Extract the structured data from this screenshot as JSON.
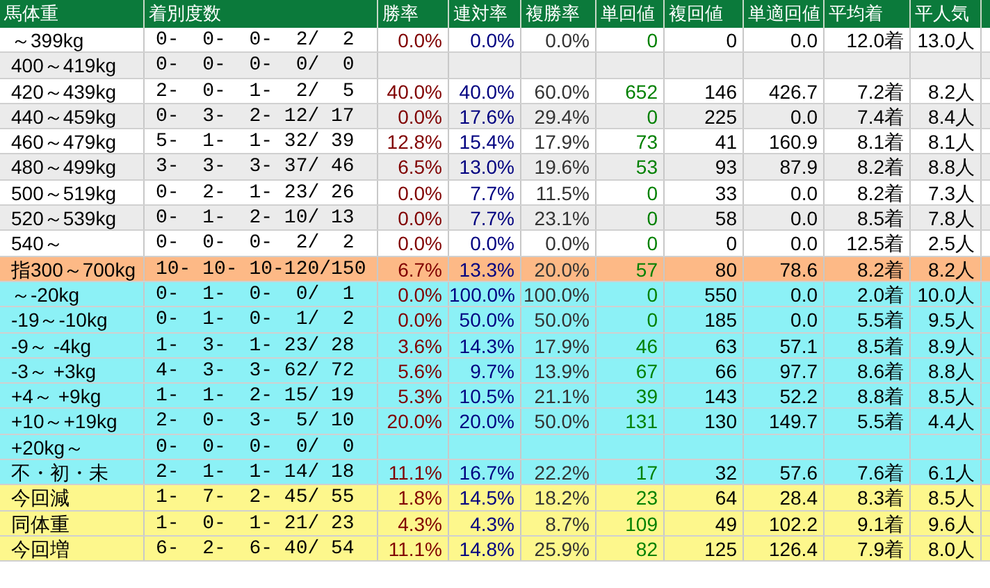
{
  "columns": [
    "馬体重",
    "着別度数",
    "勝率",
    "連対率",
    "複勝率",
    "単回値",
    "複回値",
    "単適回値",
    "平均着",
    "平人気"
  ],
  "rows": [
    {
      "kind": "weight",
      "label": "～399kg",
      "record": "0-  0-  0-  2/  2",
      "stats": [
        "0.0%",
        "0.0%",
        "0.0%",
        "0",
        "0",
        "0.0",
        "12.0着",
        "13.0人"
      ]
    },
    {
      "kind": "weight",
      "label": "400～419kg",
      "record": "0-  0-  0-  0/  0"
    },
    {
      "kind": "weight",
      "label": "420～439kg",
      "record": "2-  0-  1-  2/  5",
      "stats": [
        "40.0%",
        "40.0%",
        "60.0%",
        "652",
        "146",
        "426.7",
        "7.2着",
        "8.2人"
      ]
    },
    {
      "kind": "weight",
      "label": "440～459kg",
      "record": "0-  3-  2- 12/ 17",
      "stats": [
        "0.0%",
        "17.6%",
        "29.4%",
        "0",
        "225",
        "0.0",
        "7.4着",
        "8.4人"
      ]
    },
    {
      "kind": "weight",
      "label": "460～479kg",
      "record": "5-  1-  1- 32/ 39",
      "stats": [
        "12.8%",
        "15.4%",
        "17.9%",
        "73",
        "41",
        "160.9",
        "8.1着",
        "8.1人"
      ]
    },
    {
      "kind": "weight",
      "label": "480～499kg",
      "record": "3-  3-  3- 37/ 46",
      "stats": [
        "6.5%",
        "13.0%",
        "19.6%",
        "53",
        "93",
        "87.9",
        "8.2着",
        "8.8人"
      ]
    },
    {
      "kind": "weight",
      "label": "500～519kg",
      "record": "0-  2-  1- 23/ 26",
      "stats": [
        "0.0%",
        "7.7%",
        "11.5%",
        "0",
        "33",
        "0.0",
        "8.2着",
        "7.3人"
      ]
    },
    {
      "kind": "weight",
      "label": "520～539kg",
      "record": "0-  1-  2- 10/ 13",
      "stats": [
        "0.0%",
        "7.7%",
        "23.1%",
        "0",
        "58",
        "0.0",
        "8.5着",
        "7.8人"
      ]
    },
    {
      "kind": "weight",
      "label": "540～",
      "record": "0-  0-  0-  2/  2",
      "stats": [
        "0.0%",
        "0.0%",
        "0.0%",
        "0",
        "0",
        "0.0",
        "12.5着",
        "2.5人"
      ]
    },
    {
      "kind": "total",
      "label": "指300～700kg",
      "record": "10- 10- 10-120/150",
      "stats": [
        "6.7%",
        "13.3%",
        "20.0%",
        "57",
        "80",
        "78.6",
        "8.2着",
        "8.2人"
      ]
    },
    {
      "kind": "change",
      "label": "～-20kg",
      "record": "0-  1-  0-  0/  1",
      "stats": [
        "0.0%",
        "100.0%",
        "100.0%",
        "0",
        "550",
        "0.0",
        "2.0着",
        "10.0人"
      ]
    },
    {
      "kind": "change",
      "label": "-19～-10kg",
      "record": "0-  1-  0-  1/  2",
      "stats": [
        "0.0%",
        "50.0%",
        "50.0%",
        "0",
        "185",
        "0.0",
        "5.5着",
        "9.5人"
      ]
    },
    {
      "kind": "change",
      "label": "-9～ -4kg",
      "record": "1-  3-  1- 23/ 28",
      "stats": [
        "3.6%",
        "14.3%",
        "17.9%",
        "46",
        "63",
        "57.1",
        "8.5着",
        "8.9人"
      ]
    },
    {
      "kind": "change",
      "label": "-3～ +3kg",
      "record": "4-  3-  3- 62/ 72",
      "stats": [
        "5.6%",
        "9.7%",
        "13.9%",
        "67",
        "66",
        "97.7",
        "8.6着",
        "8.8人"
      ]
    },
    {
      "kind": "change",
      "label": "+4～ +9kg",
      "record": "1-  1-  2- 15/ 19",
      "stats": [
        "5.3%",
        "10.5%",
        "21.1%",
        "39",
        "143",
        "52.2",
        "8.8着",
        "8.5人"
      ]
    },
    {
      "kind": "change",
      "label": "+10～+19kg",
      "record": "2-  0-  3-  5/ 10",
      "stats": [
        "20.0%",
        "20.0%",
        "50.0%",
        "131",
        "130",
        "149.7",
        "5.5着",
        "4.4人"
      ]
    },
    {
      "kind": "change",
      "label": "+20kg～",
      "record": "0-  0-  0-  0/  0"
    },
    {
      "kind": "change",
      "label": "不・初・未",
      "record": "2-  1-  1- 14/ 18",
      "stats": [
        "11.1%",
        "16.7%",
        "22.2%",
        "17",
        "32",
        "57.6",
        "7.6着",
        "6.1人"
      ]
    },
    {
      "kind": "compare",
      "label": "今回減",
      "record": "1-  7-  2- 45/ 55",
      "stats": [
        "1.8%",
        "14.5%",
        "18.2%",
        "23",
        "64",
        "28.4",
        "8.3着",
        "8.5人"
      ]
    },
    {
      "kind": "compare",
      "label": "同体重",
      "record": "1-  0-  1- 21/ 23",
      "stats": [
        "4.3%",
        "4.3%",
        "8.7%",
        "109",
        "49",
        "102.2",
        "9.1着",
        "9.6人"
      ]
    },
    {
      "kind": "compare",
      "label": "今回増",
      "record": "6-  2-  6- 40/ 54",
      "stats": [
        "11.1%",
        "14.8%",
        "25.9%",
        "82",
        "125",
        "126.4",
        "7.9着",
        "8.0人"
      ]
    }
  ]
}
